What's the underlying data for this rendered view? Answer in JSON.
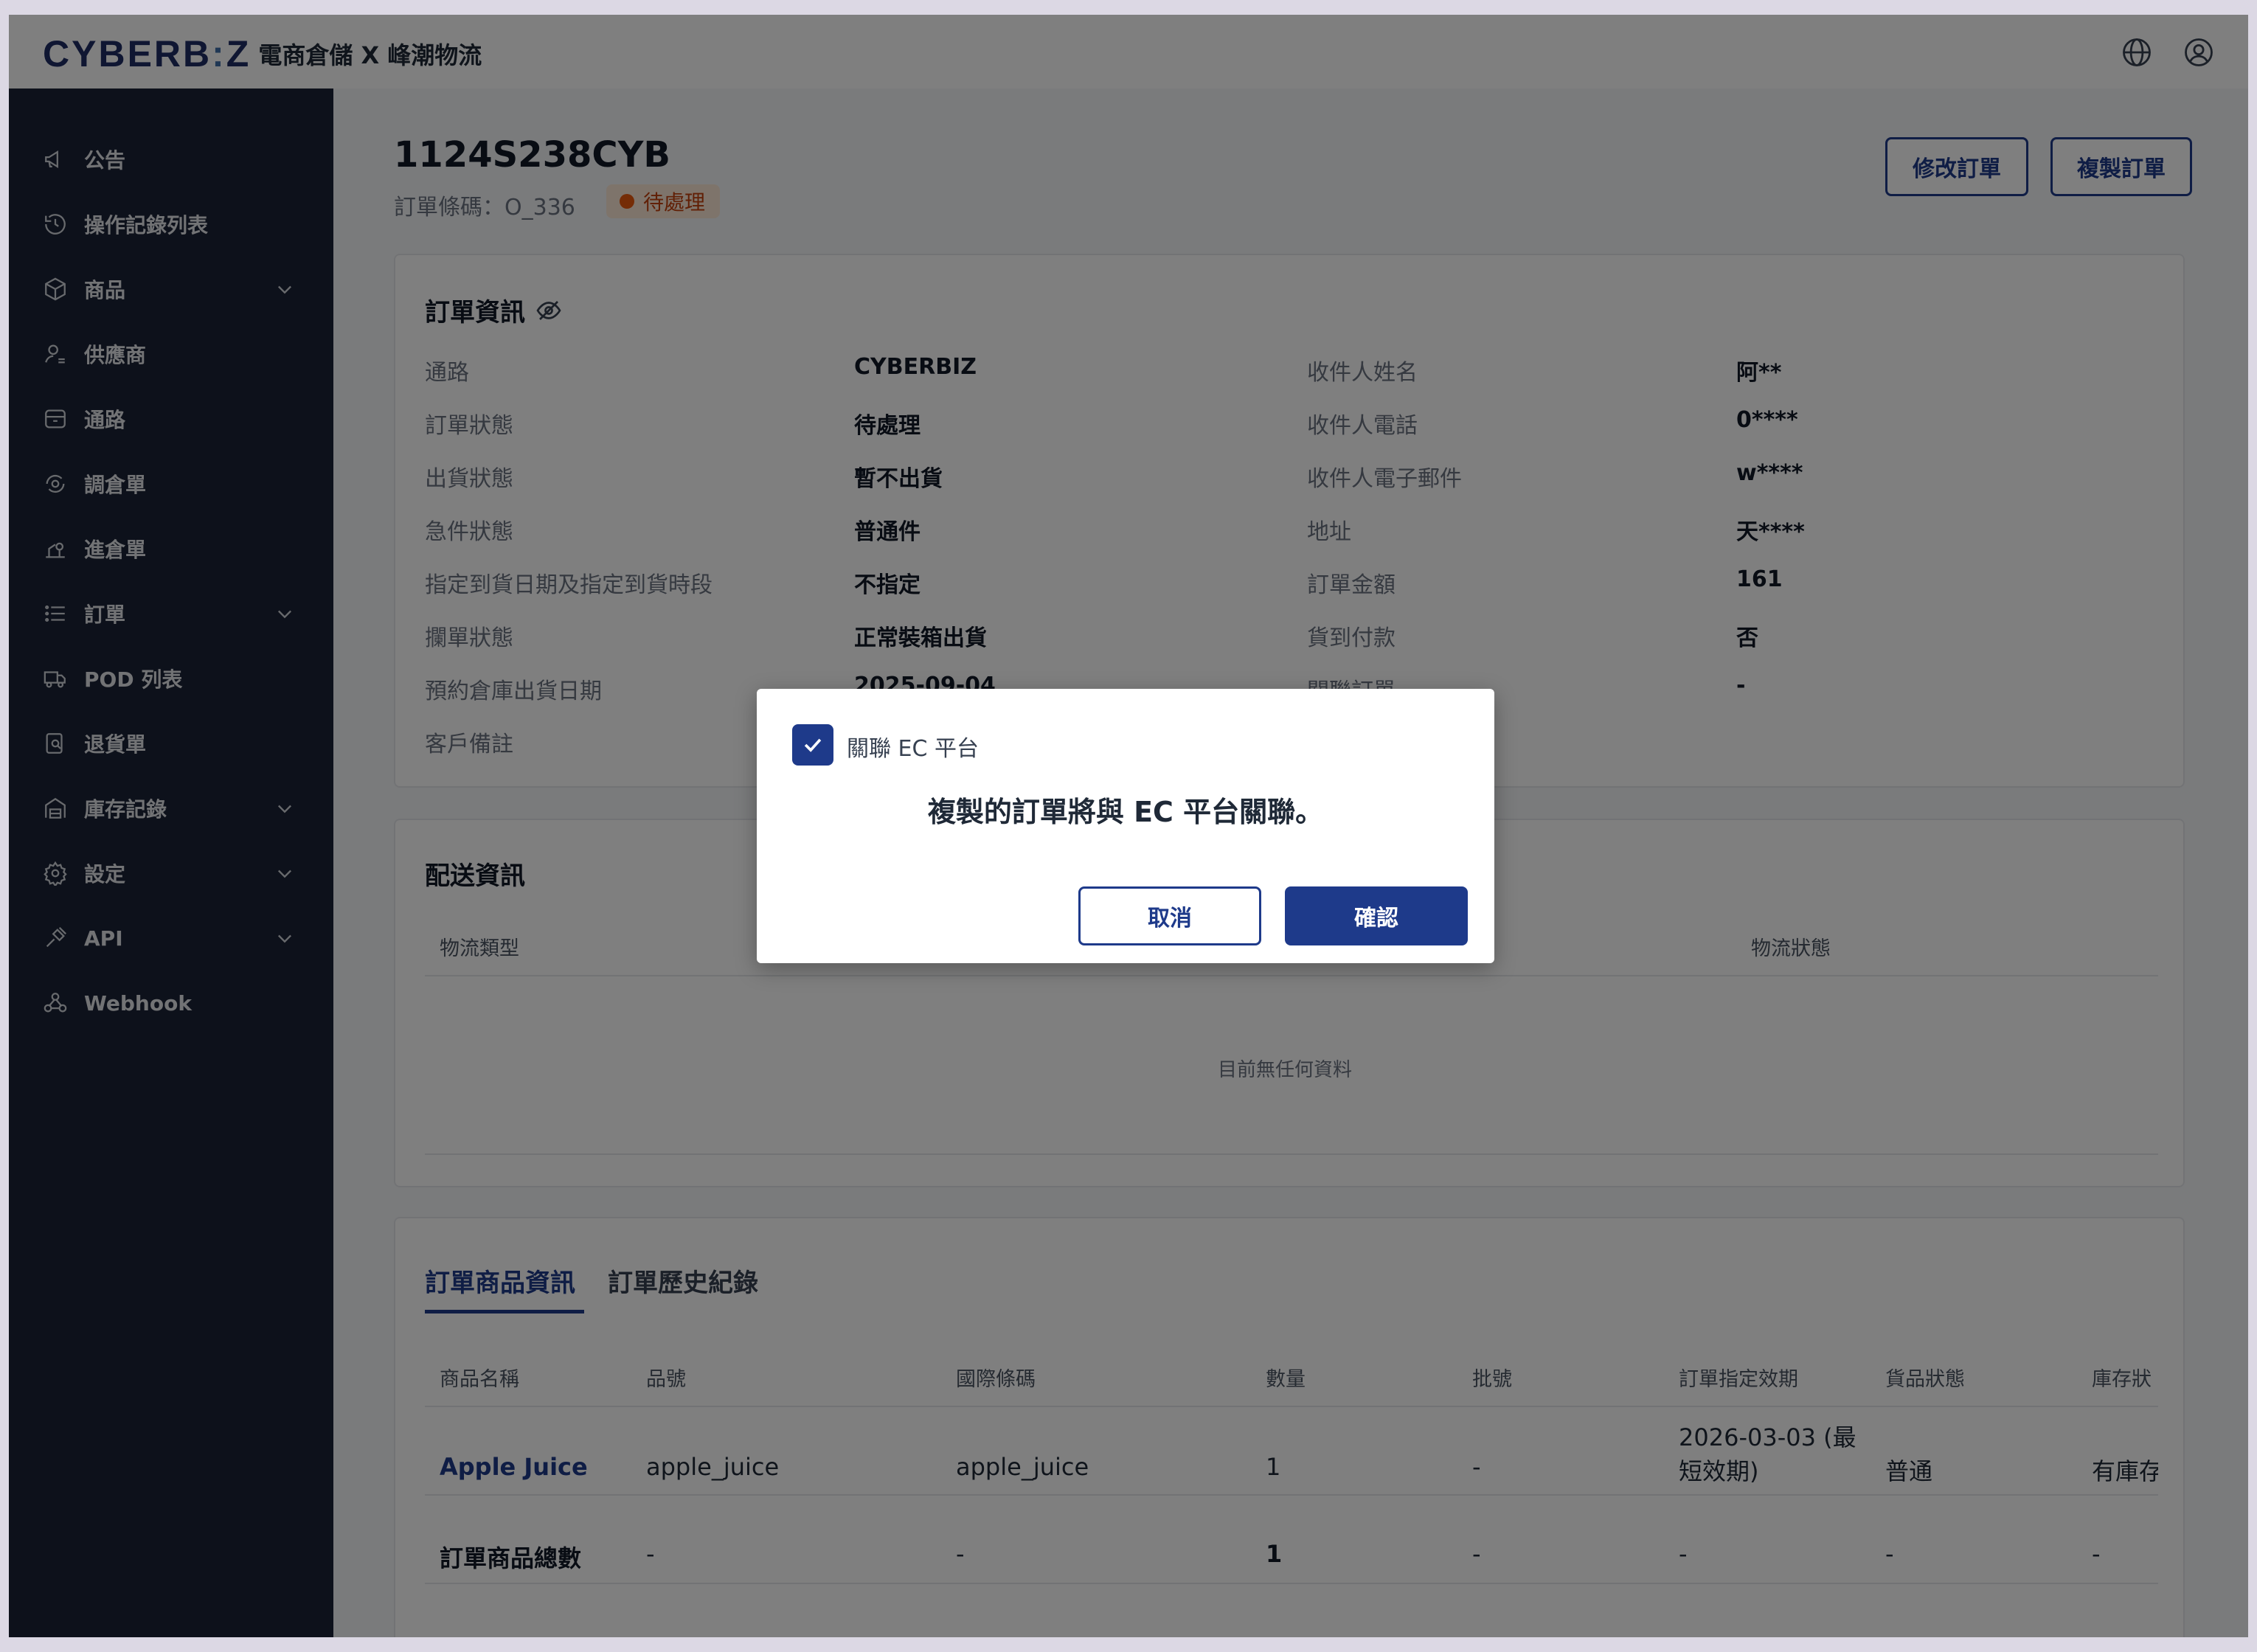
{
  "header": {
    "brand": "CYBERB",
    "brand_sep": ":",
    "brand_end": "Z",
    "subtitle": "電商倉儲 X 峰潮物流",
    "icons": [
      "globe-icon",
      "user-circle-icon"
    ]
  },
  "sidebar": {
    "items": [
      {
        "label": "公告",
        "icon": "megaphone-icon",
        "expandable": false
      },
      {
        "label": "操作記錄列表",
        "icon": "history-icon",
        "expandable": false
      },
      {
        "label": "商品",
        "icon": "box-icon",
        "expandable": true
      },
      {
        "label": "供應商",
        "icon": "user-icon",
        "expandable": false
      },
      {
        "label": "通路",
        "icon": "store-icon",
        "expandable": false
      },
      {
        "label": "調倉單",
        "icon": "transfer-icon",
        "expandable": false
      },
      {
        "label": "進倉單",
        "icon": "inbound-icon",
        "expandable": false
      },
      {
        "label": "訂單",
        "icon": "list-icon",
        "expandable": true
      },
      {
        "label": "POD 列表",
        "icon": "truck-icon",
        "expandable": false
      },
      {
        "label": "退貨單",
        "icon": "return-icon",
        "expandable": false
      },
      {
        "label": "庫存記錄",
        "icon": "warehouse-icon",
        "expandable": true
      },
      {
        "label": "設定",
        "icon": "gear-icon",
        "expandable": true
      },
      {
        "label": "API",
        "icon": "plug-icon",
        "expandable": true
      },
      {
        "label": "Webhook",
        "icon": "webhook-icon",
        "expandable": false
      }
    ]
  },
  "order": {
    "title": "1124S238CYB",
    "barcode": "訂單條碼：O_336",
    "status": "待處理",
    "edit_label": "修改訂單",
    "copy_label": "複製訂單"
  },
  "order_info": {
    "title": "訂單資訊",
    "left": [
      {
        "label": "通路",
        "value": "CYBERBIZ"
      },
      {
        "label": "訂單狀態",
        "value": "待處理"
      },
      {
        "label": "出貨狀態",
        "value": "暫不出貨"
      },
      {
        "label": "急件狀態",
        "value": "普通件"
      },
      {
        "label": "指定到貨日期及指定到貨時段",
        "value": "不指定"
      },
      {
        "label": "攔單狀態",
        "value": "正常裝箱出貨"
      },
      {
        "label": "預約倉庫出貨日期",
        "value": "2025-09-04"
      },
      {
        "label": "客戶備註",
        "value": ""
      }
    ],
    "right": [
      {
        "label": "收件人姓名",
        "value": "阿**"
      },
      {
        "label": "收件人電話",
        "value": "0****"
      },
      {
        "label": "收件人電子郵件",
        "value": "w****"
      },
      {
        "label": "地址",
        "value": "天****"
      },
      {
        "label": "訂單金額",
        "value": "161"
      },
      {
        "label": "貨到付款",
        "value": "否"
      },
      {
        "label": "關聯訂單",
        "value": "-"
      }
    ]
  },
  "shipping": {
    "title": "配送資訊",
    "col_type": "物流類型",
    "col_status": "物流狀態",
    "empty": "目前無任何資料"
  },
  "items": {
    "tabs": [
      "訂單商品資訊",
      "訂單歷史紀錄"
    ],
    "headers": [
      "商品名稱",
      "品號",
      "國際條碼",
      "數量",
      "批號",
      "訂單指定效期",
      "貨品狀態",
      "庫存狀"
    ],
    "row": {
      "name": "Apple Juice",
      "sku": "apple_juice",
      "barcode": "apple_juice",
      "qty": "1",
      "batch": "-",
      "expiry_line1": "2026-03-03 (最",
      "expiry_line2": "短效期)",
      "condition": "普通",
      "stock": "有庫存"
    },
    "total": {
      "label": "訂單商品總數",
      "sku": "-",
      "barcode": "-",
      "qty": "1",
      "batch": "-",
      "expiry": "-",
      "condition": "-",
      "stock": "-"
    }
  },
  "modal": {
    "checkbox_label": "關聯 EC 平台",
    "checked": true,
    "message": "複製的訂單將與 EC 平台關聯。",
    "cancel_label": "取消",
    "confirm_label": "確認"
  },
  "colors": {
    "primary": "#1e3a8a",
    "sidebar": "#1a2236",
    "status_orange": "#ea580c"
  }
}
